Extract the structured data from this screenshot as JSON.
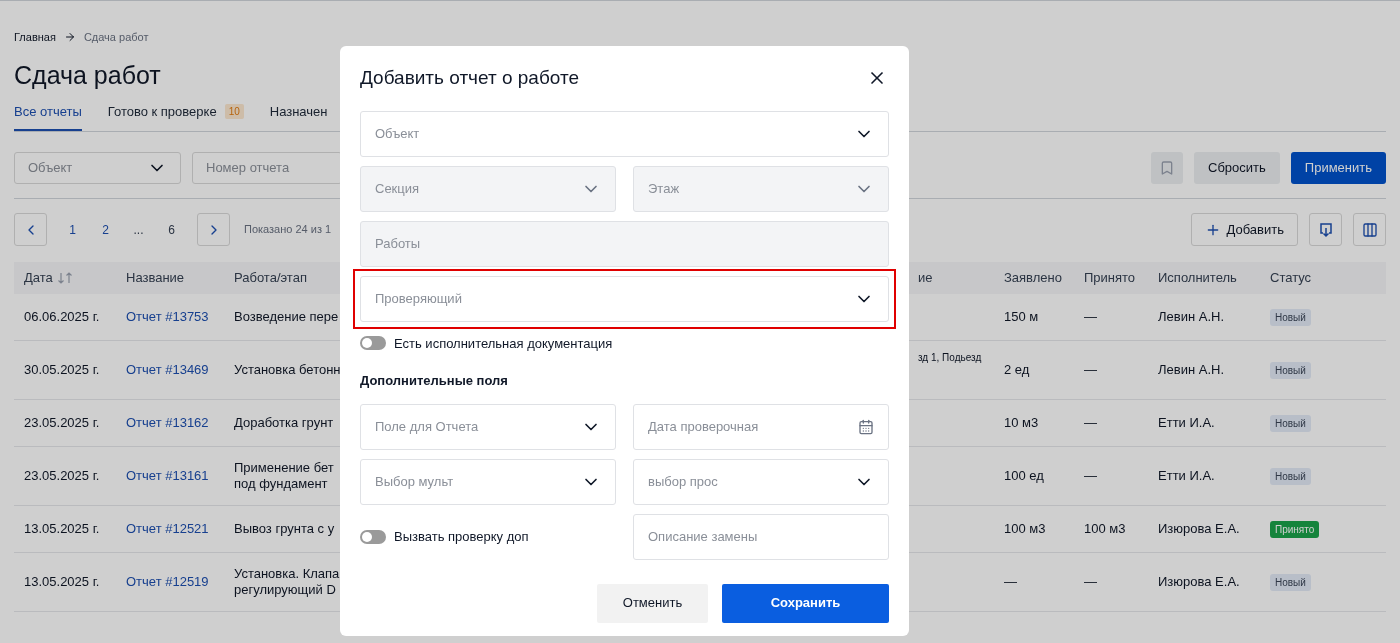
{
  "breadcrumbs": [
    {
      "label": "Главная",
      "current": false
    },
    {
      "label": "Сдача работ",
      "current": true
    }
  ],
  "title": "Сдача работ",
  "tabs": [
    {
      "label": "Все отчеты",
      "selected": true
    },
    {
      "label": "Готово к проверке",
      "badge": "10",
      "selected": false
    },
    {
      "label": "Назначен",
      "selected": false
    }
  ],
  "filters": {
    "object": {
      "placeholder": "Объект"
    },
    "report_number": {
      "placeholder": "Номер отчета"
    },
    "reset": "Сбросить",
    "apply": "Применить"
  },
  "pagination": {
    "pages": [
      {
        "label": "1",
        "selected": false
      },
      {
        "label": "2",
        "selected": false
      },
      {
        "label": "...",
        "selected": false
      },
      {
        "label": "6",
        "selected": false
      }
    ],
    "info": "Показано 24 из 1"
  },
  "add_button": "Добавить",
  "table": {
    "columns": [
      "Дата",
      "Название",
      "Работа/этап",
      "ие",
      "Заявлено",
      "Принято",
      "Исполнитель",
      "Статус"
    ],
    "rows": [
      {
        "date": "06.06.2025 г.",
        "name": "Отчет #13753",
        "work": [
          "Возведение пере"
        ],
        "column_4": "",
        "declared": "150 м",
        "accepted": "—",
        "executor": "Левин А.Н.",
        "status": {
          "label": "Новый",
          "kind": "new"
        }
      },
      {
        "date": "30.05.2025 г.",
        "name": "Отчет #13469",
        "work": [
          "Установка бетонн"
        ],
        "column_4": "зд 1, Подьезд",
        "declared": "2 ед",
        "accepted": "—",
        "executor": "Левин А.Н.",
        "status": {
          "label": "Новый",
          "kind": "new"
        }
      },
      {
        "date": "23.05.2025 г.",
        "name": "Отчет #13162",
        "work": [
          "Доработка грунт"
        ],
        "column_4": "",
        "declared": "10 м3",
        "accepted": "—",
        "executor": "Етти И.А.",
        "status": {
          "label": "Новый",
          "kind": "new"
        }
      },
      {
        "date": "23.05.2025 г.",
        "name": "Отчет #13161",
        "work": [
          "Применение бет",
          "под фундамент"
        ],
        "column_4": "",
        "declared": "100 ед",
        "accepted": "—",
        "executor": "Етти И.А.",
        "status": {
          "label": "Новый",
          "kind": "new"
        }
      },
      {
        "date": "13.05.2025 г.",
        "name": "Отчет #12521",
        "work": [
          "Вывоз грунта с у"
        ],
        "column_4": "",
        "declared": "100 м3",
        "accepted": "100 м3",
        "executor": "Изюрова Е.А.",
        "status": {
          "label": "Принято",
          "kind": "accepted"
        }
      },
      {
        "date": "13.05.2025 г.",
        "name": "Отчет #12519",
        "work": [
          "Установка. Клапа",
          "регулирующий D"
        ],
        "column_4": "",
        "declared": "—",
        "accepted": "—",
        "executor": "Изюрова Е.А.",
        "status": {
          "label": "Новый",
          "kind": "new"
        }
      }
    ]
  },
  "modal": {
    "title": "Добавить отчет о работе",
    "main_rows": [
      [
        {
          "kind": "select",
          "placeholder": "Объект",
          "disabled": false,
          "highlighted": false
        }
      ],
      [
        {
          "kind": "select",
          "placeholder": "Секция",
          "disabled": true,
          "highlighted": false
        },
        {
          "kind": "select",
          "placeholder": "Этаж",
          "disabled": true,
          "highlighted": false
        }
      ],
      [
        {
          "kind": "text",
          "placeholder": "Работы",
          "disabled": true,
          "highlighted": false
        }
      ],
      [
        {
          "kind": "select",
          "placeholder": "Проверяющий",
          "disabled": false,
          "highlighted": true
        }
      ]
    ],
    "doc_toggle": {
      "label": "Есть исполнительная документация",
      "on": false
    },
    "extra_title": "Дополнительные поля",
    "extra_rows": [
      [
        {
          "kind": "select",
          "placeholder": "Поле для Отчета",
          "disabled": false,
          "highlighted": false
        },
        {
          "kind": "date",
          "placeholder": "Дата проверочная",
          "disabled": false,
          "highlighted": false
        }
      ],
      [
        {
          "kind": "select",
          "placeholder": "Выбор мульт",
          "disabled": false,
          "highlighted": false
        },
        {
          "kind": "select",
          "placeholder": "выбор прос",
          "disabled": false,
          "highlighted": false
        }
      ],
      [
        {
          "kind": "toggle",
          "label": "Вызвать проверку доп",
          "on": false
        },
        {
          "kind": "text",
          "placeholder": "Описание замены",
          "disabled": false,
          "highlighted": false
        }
      ]
    ],
    "cancel": "Отменить",
    "save": "Сохранить"
  }
}
